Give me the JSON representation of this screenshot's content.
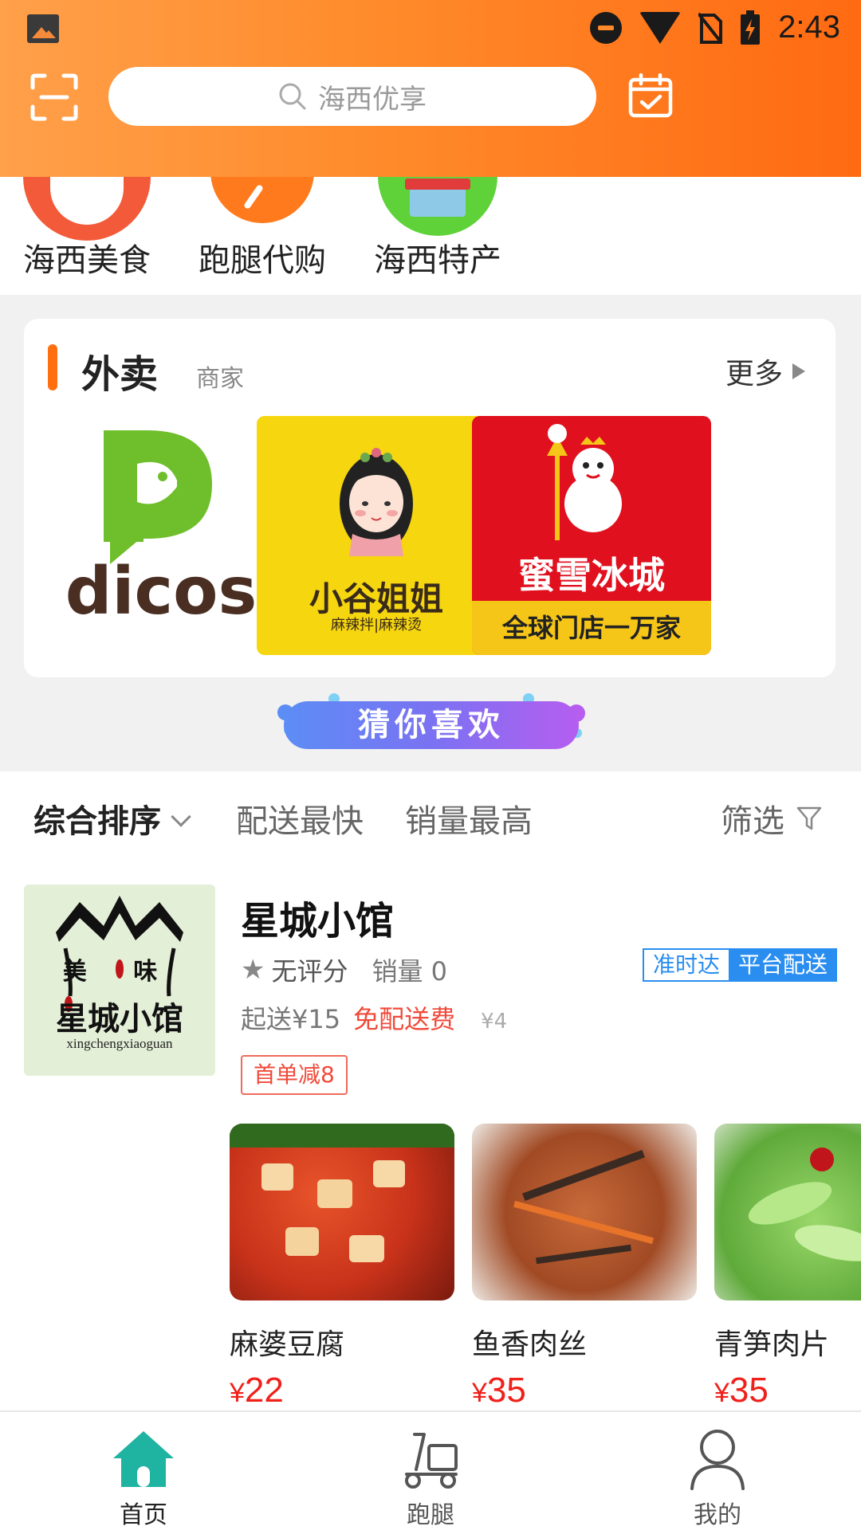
{
  "status_bar": {
    "time": "2:43",
    "icons": [
      "image-icon",
      "dnd-icon",
      "wifi-icon",
      "no-sim-icon",
      "battery-charging-icon"
    ]
  },
  "header": {
    "scan_icon": "scan-icon",
    "search_placeholder": "海西优享",
    "calendar_icon": "calendar-check-icon",
    "accent_color": "#ff7a1c"
  },
  "categories": [
    {
      "label": "海西美食",
      "icon": "food-bowl-icon"
    },
    {
      "label": "跑腿代购",
      "icon": "errand-icon"
    },
    {
      "label": "海西特产",
      "icon": "shop-icon"
    }
  ],
  "takeout": {
    "title": "外卖",
    "subtitle": "商家",
    "more": "更多",
    "merchants": [
      {
        "name": "dicos",
        "brand_color": "#6fbf2c"
      },
      {
        "name": "小谷姐姐",
        "tagline": "麻辣拌|麻辣烫",
        "brand_color": "#f5d60f"
      },
      {
        "name": "蜜雪冰城",
        "tagline": "全球门店一万家",
        "brand_color": "#e0101e"
      }
    ]
  },
  "guess_banner": "猜你喜欢",
  "sort_options": {
    "comprehensive": "综合排序",
    "fastest": "配送最快",
    "top_sales": "销量最高",
    "filter": "筛选"
  },
  "store": {
    "name": "星城小馆",
    "logo_text_top": "美 味",
    "logo_text_main": "星城小馆",
    "logo_text_pinyin": "xingchengxiaoguan",
    "rating": "无评分",
    "sales": "销量 0",
    "tag_ontime": "准时达",
    "tag_platform": "平台配送",
    "min_order": "起送¥15",
    "free_delivery": "免配送费",
    "original_fee": "¥4",
    "promo": "首单减8",
    "dishes": [
      {
        "name": "麻婆豆腐",
        "currency": "¥",
        "price": "22"
      },
      {
        "name": "鱼香肉丝",
        "currency": "¥",
        "price": "35"
      },
      {
        "name": "青笋肉片",
        "currency": "¥",
        "price": "35"
      }
    ]
  },
  "bottom_nav": [
    {
      "label": "首页",
      "icon": "home-icon",
      "active": true
    },
    {
      "label": "跑腿",
      "icon": "scooter-icon",
      "active": false
    },
    {
      "label": "我的",
      "icon": "profile-icon",
      "active": false
    }
  ],
  "colors": {
    "price": "#f0201a",
    "tag_blue": "#2a8ef0",
    "active_nav": "#1fb3a2"
  }
}
